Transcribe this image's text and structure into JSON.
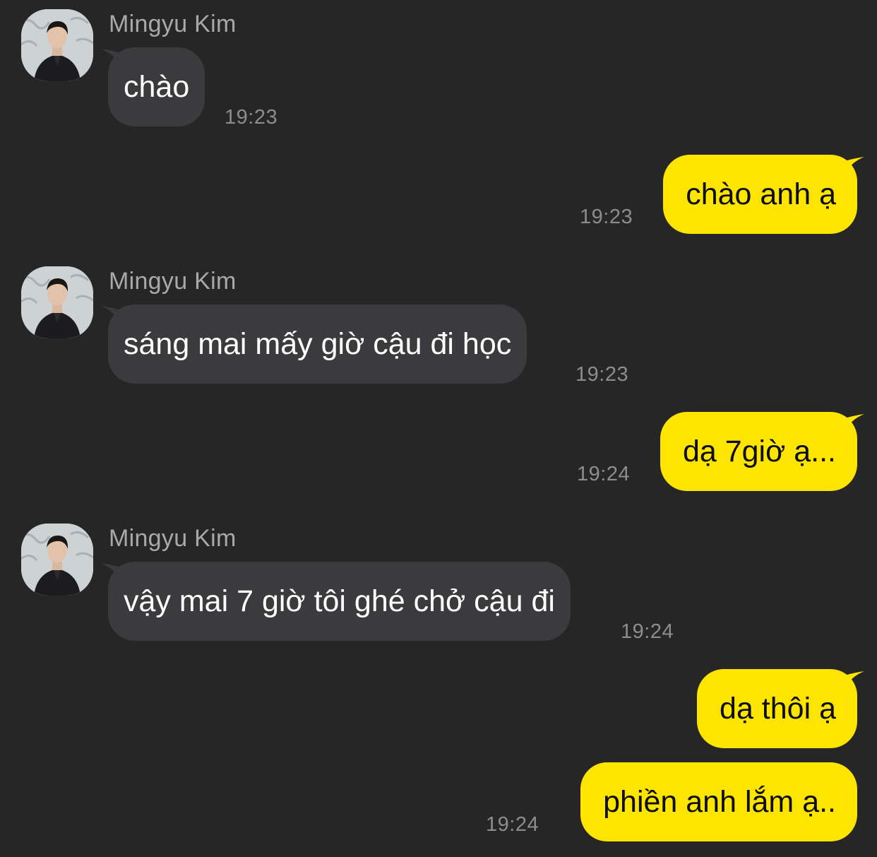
{
  "contact": {
    "name": "Mingyu Kim",
    "avatar_icon": "profile-photo"
  },
  "colors": {
    "background": "#262627",
    "incoming_bubble": "#3b3b3d",
    "outgoing_bubble": "#fde500",
    "timestamp": "#8d8d8f"
  },
  "messages": [
    {
      "direction": "in",
      "sender": "Mingyu Kim",
      "text": "chào",
      "time": "19:23"
    },
    {
      "direction": "out",
      "text": "chào anh ạ",
      "time": "19:23"
    },
    {
      "direction": "in",
      "sender": "Mingyu Kim",
      "text": "sáng mai mấy giờ cậu đi học",
      "time": "19:23"
    },
    {
      "direction": "out",
      "text": "dạ 7giờ ạ...",
      "time": "19:24"
    },
    {
      "direction": "in",
      "sender": "Mingyu Kim",
      "text": "vậy mai 7 giờ tôi ghé chở cậu đi",
      "time": "19:24"
    },
    {
      "direction": "out",
      "text": "dạ thôi ạ",
      "time": ""
    },
    {
      "direction": "out",
      "text": "phiền anh lắm ạ..",
      "time": "19:24"
    }
  ]
}
